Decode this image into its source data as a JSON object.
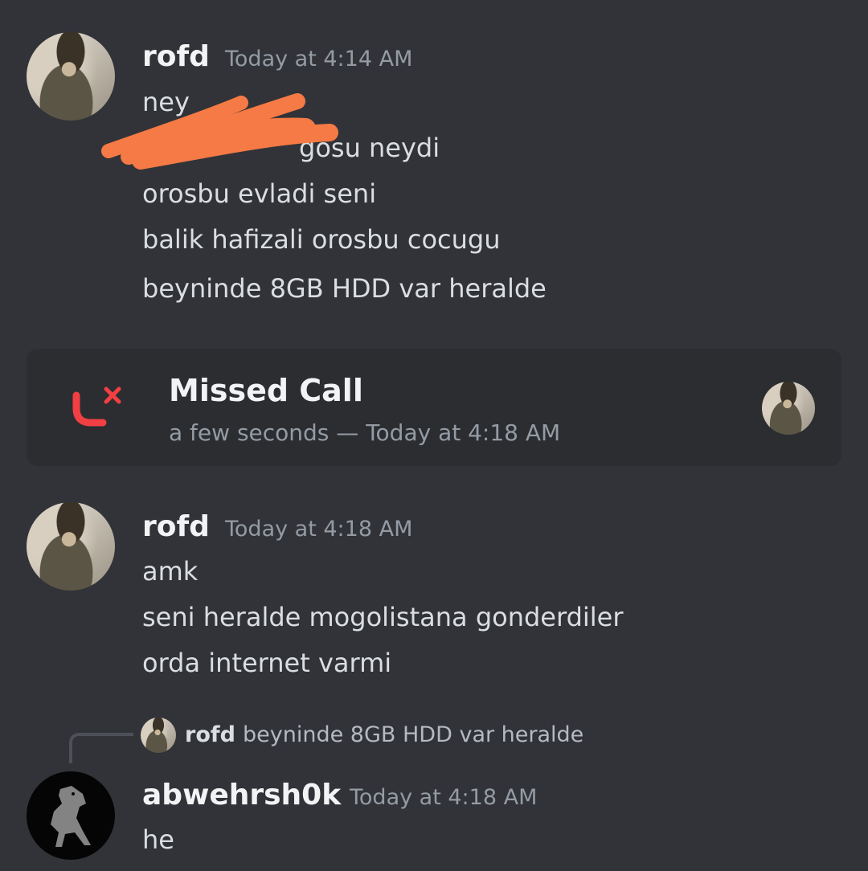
{
  "messages": [
    {
      "author": "rofd",
      "timestamp": "Today at 4:14 AM",
      "lines": [
        "ney",
        "gosu neydi",
        "orosbu evladi seni",
        "balik hafizali orosbu cocugu",
        "beyninde 8GB HDD var heralde"
      ]
    },
    {
      "author": "rofd",
      "timestamp": "Today at 4:18 AM",
      "lines": [
        "amk",
        "seni heralde mogolistana gonderdiler",
        "orda internet varmi"
      ]
    },
    {
      "author": "abwehrsh0k",
      "timestamp": "Today at 4:18 AM",
      "lines": [
        "he"
      ],
      "reply": {
        "author": "rofd",
        "text": "beyninde 8GB HDD var heralde"
      }
    }
  ],
  "call": {
    "title": "Missed Call",
    "subtitle": "a few seconds — Today at 4:18 AM",
    "icon": "missed-call-icon",
    "icon_color": "#f23f43"
  },
  "colors": {
    "background": "#313338",
    "card": "#2b2d31",
    "redaction": "#f57a45"
  }
}
